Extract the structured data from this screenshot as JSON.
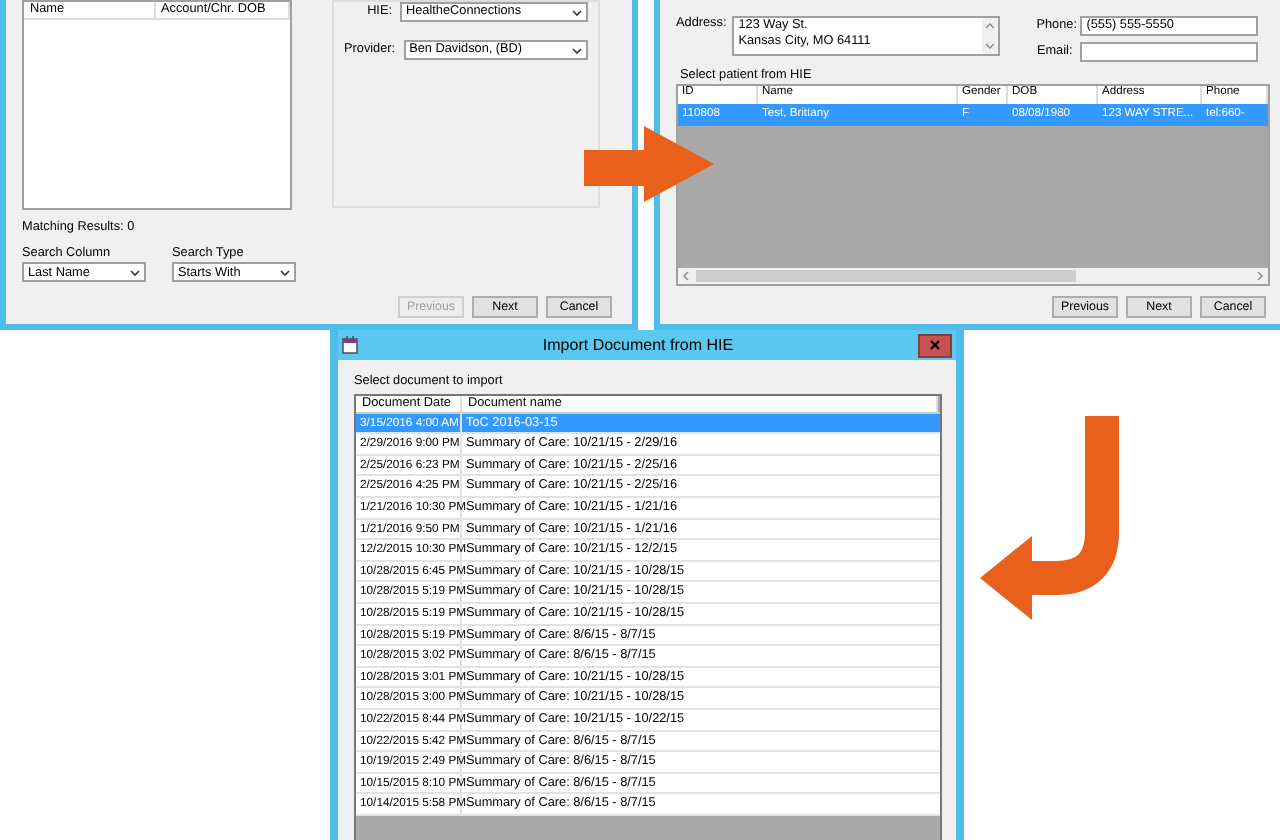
{
  "search_window": {
    "list_columns": [
      "Name",
      "Account/Chr. DOB"
    ],
    "matching_results": "Matching Results: 0",
    "search_column": {
      "label": "Search Column",
      "value": "Last Name"
    },
    "search_type": {
      "label": "Search Type",
      "value": "Starts With"
    },
    "hie": {
      "label": "HIE:",
      "value": "HealtheConnections"
    },
    "provider": {
      "label": "Provider:",
      "value": "Ben Davidson,  (BD)"
    },
    "buttons": [
      {
        "label": "Previous",
        "disabled": true
      },
      {
        "label": "Next",
        "disabled": false
      },
      {
        "label": "Cancel",
        "disabled": false
      }
    ]
  },
  "patient_window": {
    "address": {
      "label": "Address:",
      "value": "123 Way St.\nKansas City, MO 64111"
    },
    "phone": {
      "label": "Phone:",
      "value": "(555) 555-5550"
    },
    "email": {
      "label": "Email:"
    },
    "group_label": "Select patient from HIE",
    "columns": [
      "ID",
      "Name",
      "Gender",
      "DOB",
      "Address",
      "Phone"
    ],
    "rows": [
      {
        "cells": [
          "110808",
          "Test,  Brittany",
          "F",
          "08/08/1980",
          "123 WAY STRE...",
          "tel:660-"
        ],
        "selected": true
      }
    ],
    "buttons": [
      {
        "label": "Previous",
        "disabled": false
      },
      {
        "label": "Next",
        "disabled": false
      },
      {
        "label": "Cancel",
        "disabled": false
      }
    ]
  },
  "import_window": {
    "title": "Import Document from HIE",
    "prompt": "Select document to import",
    "columns": [
      "Document Date",
      "Document name"
    ],
    "rows": [
      {
        "date": "3/15/2016 4:00 AM",
        "name": "ToC 2016-03-15",
        "selected": true
      },
      {
        "date": "2/29/2016 9:00 PM",
        "name": "Summary of Care: 10/21/15 - 2/29/16",
        "selected": false
      },
      {
        "date": "2/25/2016 6:23 PM",
        "name": "Summary of Care: 10/21/15 - 2/25/16",
        "selected": false
      },
      {
        "date": "2/25/2016 4:25 PM",
        "name": "Summary of Care: 10/21/15 - 2/25/16",
        "selected": false
      },
      {
        "date": "1/21/2016 10:30 PM",
        "name": "Summary of Care: 10/21/15 - 1/21/16",
        "selected": false
      },
      {
        "date": "1/21/2016 9:50 PM",
        "name": "Summary of Care: 10/21/15 - 1/21/16",
        "selected": false
      },
      {
        "date": "12/2/2015 10:30 PM",
        "name": "Summary of Care: 10/21/15 - 12/2/15",
        "selected": false
      },
      {
        "date": "10/28/2015 6:45 PM",
        "name": "Summary of Care: 10/21/15 - 10/28/15",
        "selected": false
      },
      {
        "date": "10/28/2015 5:19 PM",
        "name": "Summary of Care: 10/21/15 - 10/28/15",
        "selected": false
      },
      {
        "date": "10/28/2015 5:19 PM",
        "name": "Summary of Care: 10/21/15 - 10/28/15",
        "selected": false
      },
      {
        "date": "10/28/2015 5:19 PM",
        "name": "Summary of Care: 8/6/15 - 8/7/15",
        "selected": false
      },
      {
        "date": "10/28/2015 3:02 PM",
        "name": "Summary of Care: 8/6/15 - 8/7/15",
        "selected": false
      },
      {
        "date": "10/28/2015 3:01 PM",
        "name": "Summary of Care: 10/21/15 - 10/28/15",
        "selected": false
      },
      {
        "date": "10/28/2015 3:00 PM",
        "name": "Summary of Care: 10/21/15 - 10/28/15",
        "selected": false
      },
      {
        "date": "10/22/2015 8:44 PM",
        "name": "Summary of Care: 10/21/15 - 10/22/15",
        "selected": false
      },
      {
        "date": "10/22/2015 5:42 PM",
        "name": "Summary of Care: 8/6/15 - 8/7/15",
        "selected": false
      },
      {
        "date": "10/19/2015 2:49 PM",
        "name": "Summary of Care: 8/6/15 - 8/7/15",
        "selected": false
      },
      {
        "date": "10/15/2015 8:10 PM",
        "name": "Summary of Care: 8/6/15 - 8/7/15",
        "selected": false
      },
      {
        "date": "10/14/2015 5:58 PM",
        "name": "Summary of Care: 8/6/15 - 8/7/15",
        "selected": false
      }
    ]
  }
}
